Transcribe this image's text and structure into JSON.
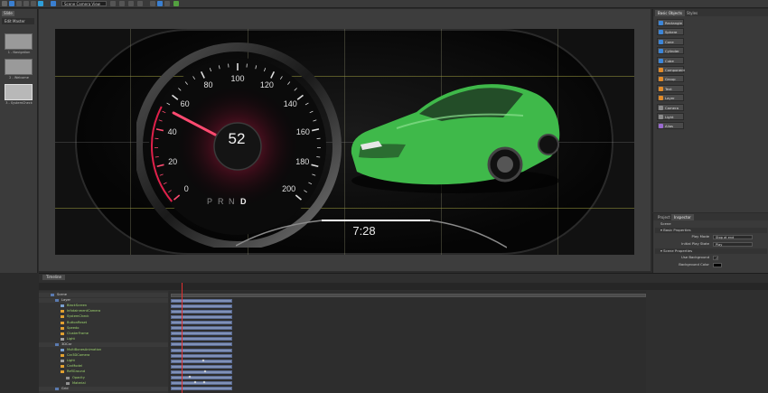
{
  "toolbar": {
    "camera_select": "Scene Camera View",
    "colors": {
      "play": "#3a7fd0",
      "add": "#2f9ed8",
      "green": "#53a040"
    }
  },
  "slides": {
    "tab": "Slide",
    "master_button": "Edit Master",
    "items": [
      {
        "label": "1 - Navigation"
      },
      {
        "label": "2 - Welcome"
      },
      {
        "label": "3 - SystemCheck"
      }
    ]
  },
  "scene": {
    "speed_ticks": [
      "0",
      "20",
      "40",
      "60",
      "80",
      "100",
      "120",
      "140",
      "160",
      "180",
      "200"
    ],
    "speed_value": "52",
    "gears": [
      "P",
      "R",
      "N",
      "D"
    ],
    "active_gear": "D",
    "clock": "7:28",
    "car_color": "#3fb94a",
    "needle_color": "#ff3b66"
  },
  "basic_objects": {
    "tabs": [
      "Basic Objects",
      "Styles"
    ],
    "items": [
      {
        "label": "Rectangle",
        "icon": "rectangle-icon",
        "color": "#3d86d8"
      },
      {
        "label": "Sphere",
        "icon": "sphere-icon",
        "color": "#3d86d8"
      },
      {
        "label": "Cone",
        "icon": "cone-icon",
        "color": "#3d86d8"
      },
      {
        "label": "Cylinder",
        "icon": "cylinder-icon",
        "color": "#3d86d8"
      },
      {
        "label": "Cube",
        "icon": "cube-icon",
        "color": "#3d86d8"
      },
      {
        "label": "Component",
        "icon": "component-icon",
        "color": "#e08a2a"
      },
      {
        "label": "Group",
        "icon": "group-icon",
        "color": "#e08a2a"
      },
      {
        "label": "Text",
        "icon": "text-icon",
        "color": "#e08a2a"
      },
      {
        "label": "Layer",
        "icon": "layer-icon",
        "color": "#e08a2a"
      },
      {
        "label": "Camera",
        "icon": "camera-icon",
        "color": "#8a8a8a"
      },
      {
        "label": "Light",
        "icon": "light-icon",
        "color": "#8a8a8a"
      },
      {
        "label": "Alias",
        "icon": "alias-icon",
        "color": "#9a6ad0"
      }
    ]
  },
  "properties": {
    "tabs": [
      "Project",
      "Inspector"
    ],
    "object_name": "Scene",
    "rows": [
      {
        "section": "Basic Properties"
      },
      {
        "label": "Play Mode",
        "value": "Stop at end"
      },
      {
        "label": "Initial Play State",
        "value": "Play"
      },
      {
        "section": "Scene Properties"
      },
      {
        "label": "Use Background",
        "value": "✓"
      },
      {
        "label": "Background Color",
        "value": ""
      }
    ]
  },
  "timeline": {
    "tab": "Timeline",
    "rows": [
      {
        "label": "Scene",
        "indent": 3,
        "color": "#5a7ab0"
      },
      {
        "label": "Layer",
        "indent": 8,
        "color": "#5a7ab0"
      },
      {
        "label": "BlackScreen",
        "indent": 14,
        "color": "#7aa0d0"
      },
      {
        "label": "InfotainmentCamera",
        "indent": 14,
        "color": "#e0a030"
      },
      {
        "label": "SystemCheck",
        "indent": 14,
        "color": "#e0a030"
      },
      {
        "label": "ButtonReset",
        "indent": 14,
        "color": "#e0a030"
      },
      {
        "label": "Speedo",
        "indent": 14,
        "color": "#e0a030"
      },
      {
        "label": "ClusterFrame",
        "indent": 14,
        "color": "#e0a030"
      },
      {
        "label": "Light",
        "indent": 14,
        "color": "#a0a0a0"
      },
      {
        "label": "3DCar",
        "indent": 8,
        "color": "#5a7ab0"
      },
      {
        "label": "MultiBonesAnimation",
        "indent": 14,
        "color": "#7aa0d0"
      },
      {
        "label": "Car3DCamera",
        "indent": 14,
        "color": "#e0a030"
      },
      {
        "label": "Light",
        "indent": 14,
        "color": "#a0a0a0"
      },
      {
        "label": "CarModel",
        "indent": 14,
        "color": "#e0a030"
      },
      {
        "label": "ReflGround",
        "indent": 14,
        "color": "#e0a030"
      },
      {
        "label": "Opacity",
        "indent": 20,
        "color": "#909090"
      },
      {
        "label": "Material",
        "indent": 20,
        "color": "#909090"
      },
      {
        "label": "Grid",
        "indent": 8,
        "color": "#5a7ab0"
      }
    ]
  }
}
